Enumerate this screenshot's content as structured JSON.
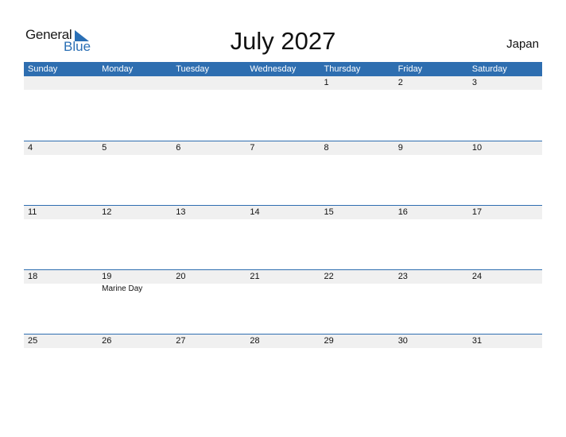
{
  "logo": {
    "general": "General",
    "blue": "Blue"
  },
  "title": "July 2027",
  "country": "Japan",
  "weekdays": [
    "Sunday",
    "Monday",
    "Tuesday",
    "Wednesday",
    "Thursday",
    "Friday",
    "Saturday"
  ],
  "weeks": [
    [
      {
        "day": ""
      },
      {
        "day": ""
      },
      {
        "day": ""
      },
      {
        "day": ""
      },
      {
        "day": "1"
      },
      {
        "day": "2"
      },
      {
        "day": "3"
      }
    ],
    [
      {
        "day": "4"
      },
      {
        "day": "5"
      },
      {
        "day": "6"
      },
      {
        "day": "7"
      },
      {
        "day": "8"
      },
      {
        "day": "9"
      },
      {
        "day": "10"
      }
    ],
    [
      {
        "day": "11"
      },
      {
        "day": "12"
      },
      {
        "day": "13"
      },
      {
        "day": "14"
      },
      {
        "day": "15"
      },
      {
        "day": "16"
      },
      {
        "day": "17"
      }
    ],
    [
      {
        "day": "18"
      },
      {
        "day": "19",
        "holiday": "Marine Day"
      },
      {
        "day": "20"
      },
      {
        "day": "21"
      },
      {
        "day": "22"
      },
      {
        "day": "23"
      },
      {
        "day": "24"
      }
    ],
    [
      {
        "day": "25"
      },
      {
        "day": "26"
      },
      {
        "day": "27"
      },
      {
        "day": "28"
      },
      {
        "day": "29"
      },
      {
        "day": "30"
      },
      {
        "day": "31"
      }
    ]
  ],
  "colors": {
    "accent": "#2e6eb0",
    "strip": "#f0f0f0"
  }
}
